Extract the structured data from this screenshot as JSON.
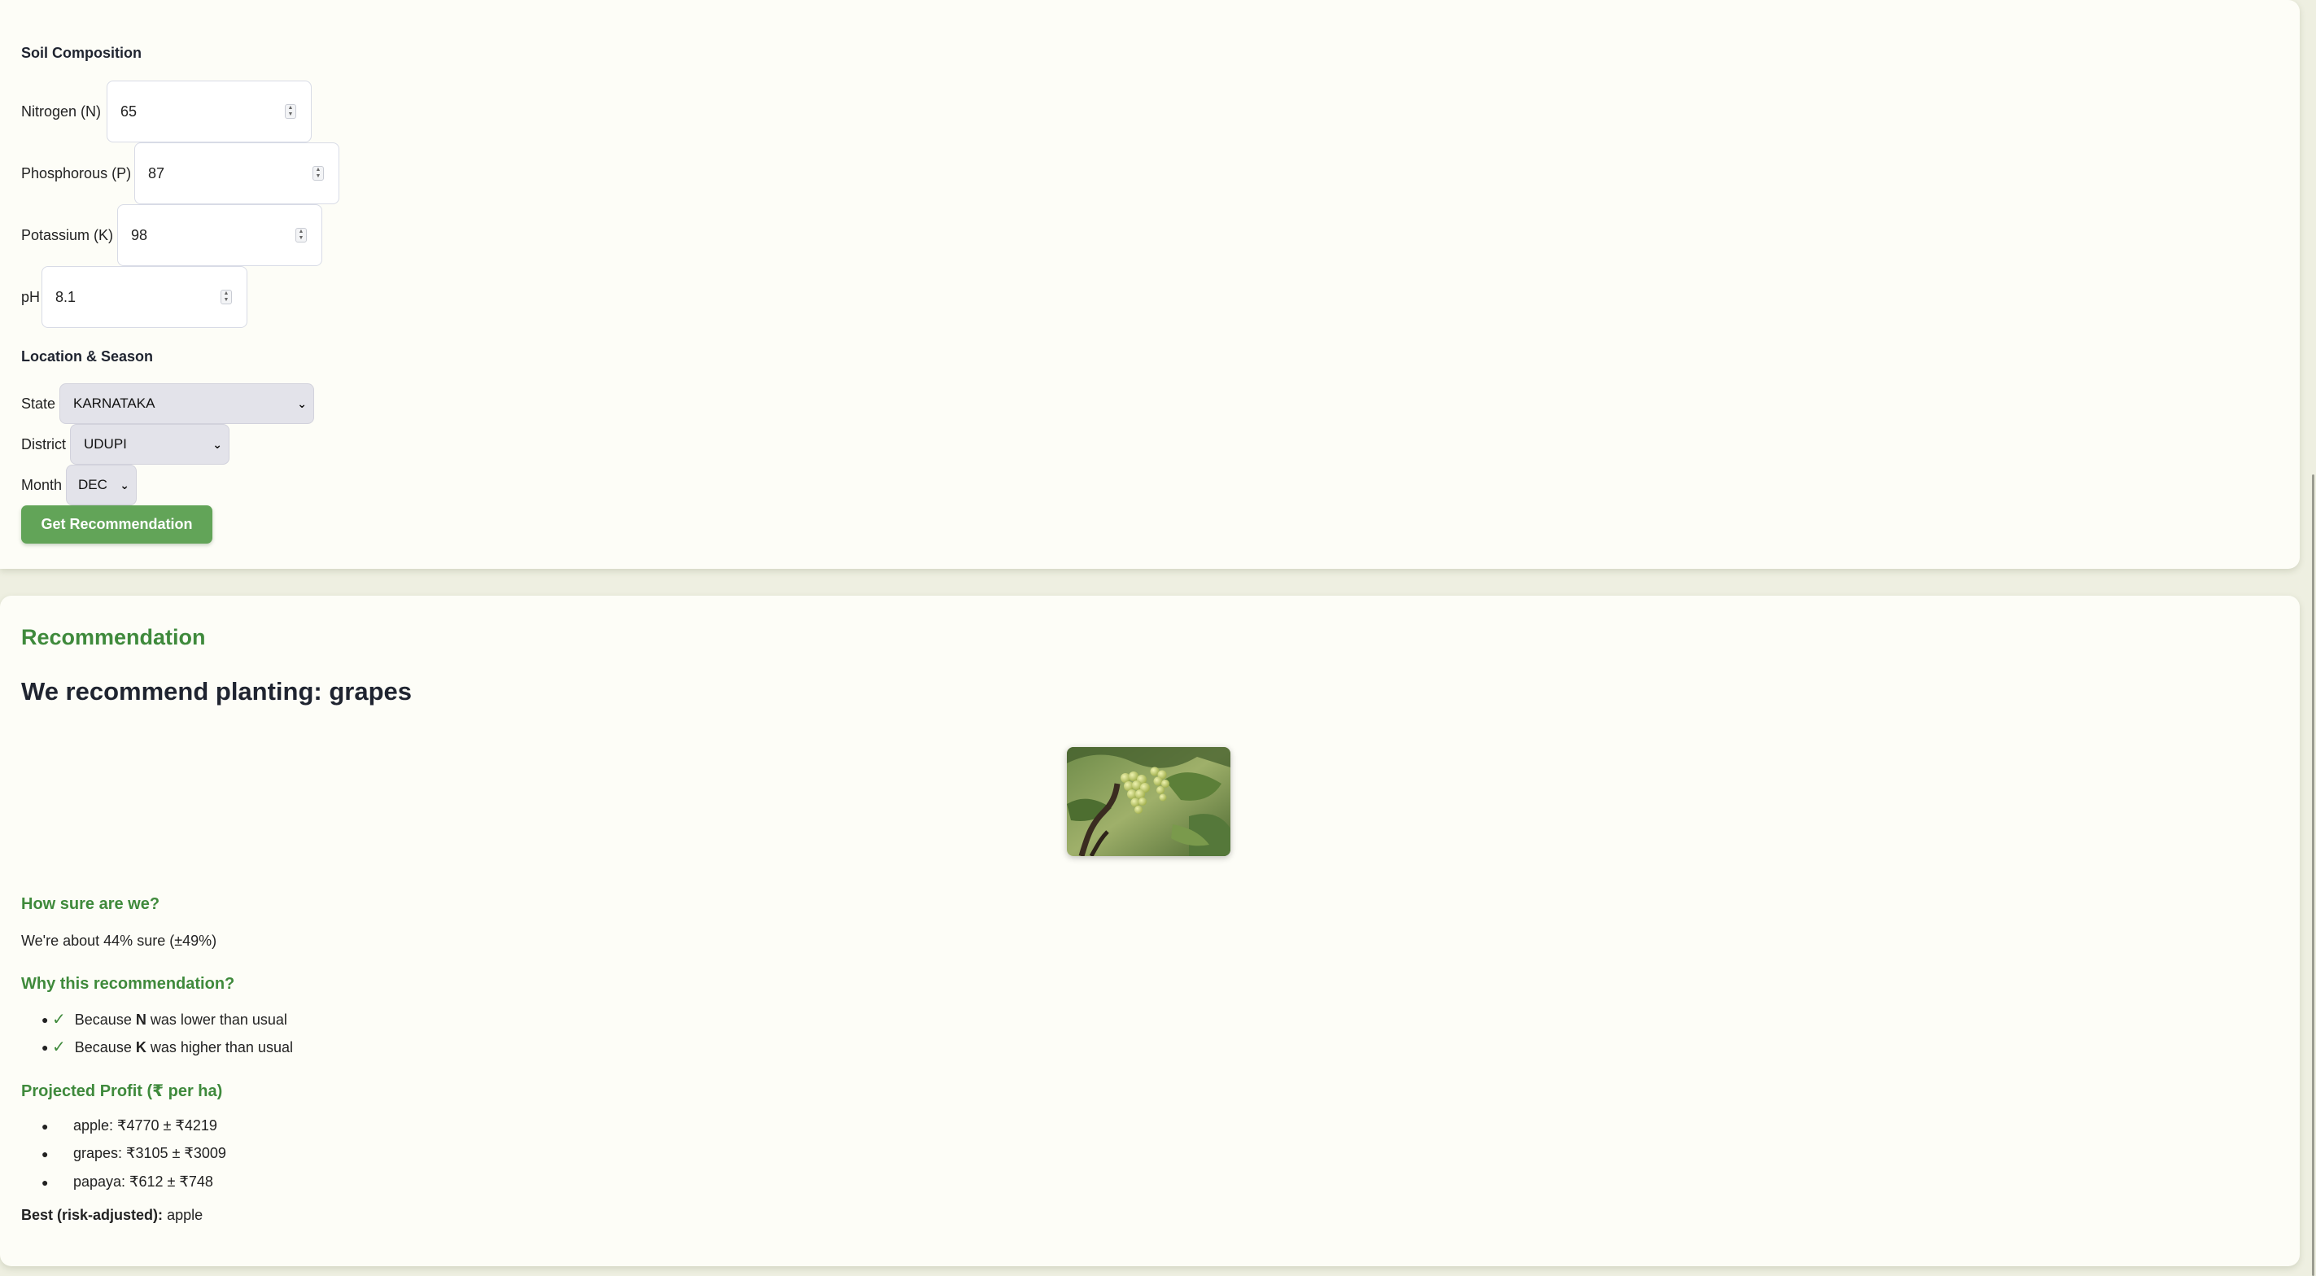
{
  "form": {
    "soil_title": "Soil Composition",
    "nitrogen": {
      "label": "Nitrogen (N)",
      "value": "65"
    },
    "phosphorous": {
      "label": "Phosphorous (P)",
      "value": "87"
    },
    "potassium": {
      "label": "Potassium (K)",
      "value": "98"
    },
    "ph": {
      "label": "pH",
      "value": "8.1"
    },
    "location_title": "Location & Season",
    "state": {
      "label": "State",
      "value": "KARNATAKA"
    },
    "district": {
      "label": "District",
      "value": "UDUPI"
    },
    "month": {
      "label": "Month",
      "value": "DEC"
    },
    "submit_label": "Get Recommendation"
  },
  "recommendation": {
    "section_title": "Recommendation",
    "headline": "We recommend planting: grapes",
    "image_icon": "grapes-photo",
    "confidence_title": "How sure are we?",
    "confidence_text": "We're about 44% sure (±49%)",
    "why_title": "Why this recommendation?",
    "reasons": [
      {
        "prefix": "Because ",
        "nutrient": "N",
        "suffix": " was lower than usual"
      },
      {
        "prefix": "Because ",
        "nutrient": "K",
        "suffix": " was higher than usual"
      }
    ],
    "profit_title": "Projected Profit (₹ per ha)",
    "profits": [
      "apple: ₹4770 ± ₹4219",
      "grapes: ₹3105 ± ₹3009",
      "papaya: ₹612 ± ₹748"
    ],
    "best_label": "Best (risk-adjusted):",
    "best_value": "apple"
  },
  "colors": {
    "page_bg": "#eeefe1",
    "card_bg": "#fdfdf7",
    "accent_green": "#3f8a3c",
    "button_green": "#62a458"
  }
}
